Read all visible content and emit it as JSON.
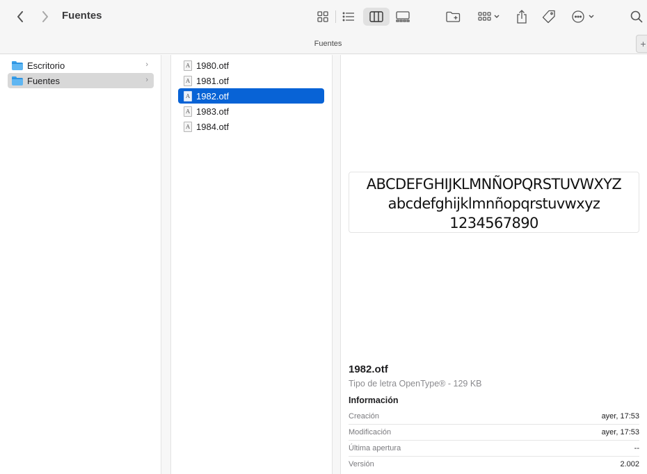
{
  "window": {
    "title": "Fuentes"
  },
  "toolbar": {
    "icons": [
      "chevron-left-icon",
      "chevron-right-icon",
      "icon-view-icon",
      "list-view-icon",
      "column-view-icon",
      "gallery-view-icon",
      "new-folder-icon",
      "group-icon",
      "share-icon",
      "tag-icon",
      "more-icon",
      "search-icon"
    ],
    "active_view": "column-view"
  },
  "pathbar": {
    "label": "Fuentes",
    "plus": "+"
  },
  "sidebar": {
    "items": [
      {
        "label": "Escritorio",
        "chevron": "›",
        "selected": false
      },
      {
        "label": "Fuentes",
        "chevron": "›",
        "selected": true
      }
    ]
  },
  "files": {
    "items": [
      {
        "label": "1980.otf",
        "selected": false
      },
      {
        "label": "1981.otf",
        "selected": false
      },
      {
        "label": "1982.otf",
        "selected": true
      },
      {
        "label": "1983.otf",
        "selected": false
      },
      {
        "label": "1984.otf",
        "selected": false
      }
    ]
  },
  "preview": {
    "sample": {
      "line1": "ABCDEFGHIJKLMNÑOPQRSTUVWXYZ",
      "line2": "abcdefghijklmnñopqrstuvwxyz",
      "line3": "1234567890"
    },
    "name": "1982.otf",
    "type": "Tipo de letra OpenType® - 129 KB",
    "info_heading": "Información",
    "info": [
      {
        "key": "Creación",
        "value": "ayer, 17:53"
      },
      {
        "key": "Modificación",
        "value": "ayer, 17:53"
      },
      {
        "key": "Última apertura",
        "value": "--"
      },
      {
        "key": "Versión",
        "value": "2.002"
      }
    ]
  },
  "colors": {
    "selection": "#0863d6",
    "folder": "#5fb6f2",
    "toolbar_bg": "#f6f6f6"
  }
}
